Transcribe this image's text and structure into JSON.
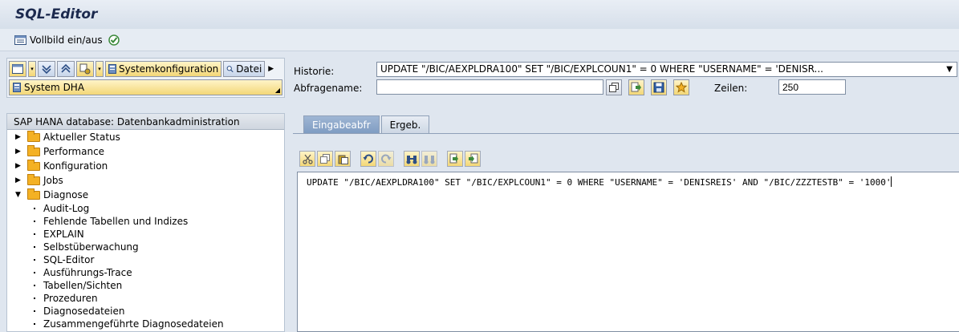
{
  "window": {
    "title": "SQL-Editor"
  },
  "toolbar": {
    "fullscreen_label": "Vollbild ein/aus"
  },
  "left_panel": {
    "systemconfig_button": "Systemkonfiguration",
    "datei_button": "Datei",
    "system_label": "System DHA",
    "tree": {
      "header": "SAP HANA database: Datenbankadministration",
      "folders": [
        {
          "label": "Aktueller Status",
          "expanded": false
        },
        {
          "label": "Performance",
          "expanded": false
        },
        {
          "label": "Konfiguration",
          "expanded": false
        },
        {
          "label": "Jobs",
          "expanded": false
        },
        {
          "label": "Diagnose",
          "expanded": true
        }
      ],
      "diagnose_items": [
        "Audit-Log",
        "Fehlende Tabellen und Indizes",
        "EXPLAIN",
        "Selbstüberwachung",
        "SQL-Editor",
        "Ausführungs-Trace",
        "Tabellen/Sichten",
        "Prozeduren",
        "Diagnosedateien",
        "Zusammengeführte Diagnosedateien"
      ]
    }
  },
  "right_panel": {
    "historie_label": "Historie:",
    "historie_value": "UPDATE \"/BIC/AEXPLDRA100\" SET \"/BIC/EXPLCOUN1\" = 0 WHERE \"USERNAME\" = 'DENISR...",
    "abfragename_label": "Abfragename:",
    "abfragename_value": "",
    "zeilen_label": "Zeilen:",
    "zeilen_value": "250",
    "tabs": [
      "Eingabeabfr",
      "Ergeb."
    ],
    "sql_text": "UPDATE \"/BIC/AEXPLDRA100\" SET \"/BIC/EXPLCOUN1\" = 0 WHERE \"USERNAME\" = 'DENISREIS' AND \"/BIC/ZZZTESTB\" = '1000'"
  }
}
